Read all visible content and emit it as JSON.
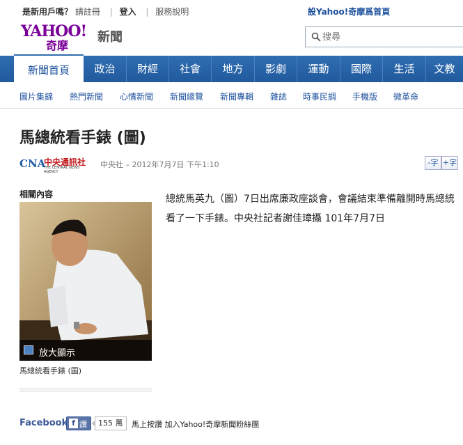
{
  "topbar": {
    "new_user_prompt": "是新用戶嗎？",
    "register": "請註冊",
    "login": "登入",
    "service_info": "服務說明",
    "set_homepage": "設Yahoo!奇摩爲首頁"
  },
  "logo": {
    "brand": "YAHOO!",
    "brand_zh": "奇摩",
    "section": "新聞"
  },
  "search": {
    "placeholder": "搜尋"
  },
  "main_nav": [
    {
      "label": "新聞首頁",
      "active": true
    },
    {
      "label": "政治"
    },
    {
      "label": "財經"
    },
    {
      "label": "社會"
    },
    {
      "label": "地方"
    },
    {
      "label": "影劇"
    },
    {
      "label": "運動"
    },
    {
      "label": "國際"
    },
    {
      "label": "生活"
    },
    {
      "label": "文教"
    }
  ],
  "sub_nav": [
    "圖片集錦",
    "熱門新聞",
    "心情新聞",
    "新聞總覽",
    "新聞專輯",
    "雜誌",
    "時事民調",
    "手機版",
    "微革命"
  ],
  "article": {
    "title": "馬總統看手錶 (圖)",
    "source_logo_mark": "CNA",
    "source_logo_zh": "中央通訊社",
    "source_logo_en": "THE CENTRAL NEWS AGENCY",
    "byline": "中央社 – 2012年7月7日 下午1:10",
    "font_smaller": "-字",
    "font_larger": "+字",
    "body": "總統馬英九（圖）7日出席廉政座談會，會議結束準備離開時馬總統看了一下手錶。中央社記者謝佳璋攝 101年7月7日"
  },
  "related": {
    "heading": "相關內容",
    "zoom_label": "放大顯示",
    "caption": "馬總統看手錶 (圖)"
  },
  "facebook": {
    "title": "Facebook",
    "like_label": "讚",
    "like_count": "155 萬",
    "cta": "馬上按讚 加入Yahoo!奇摩新聞粉絲團"
  },
  "colors": {
    "nav_blue": "#215a9d",
    "link_blue": "#1a4f9c",
    "yahoo_purple": "#7b0099",
    "facebook_blue": "#3b5998"
  }
}
